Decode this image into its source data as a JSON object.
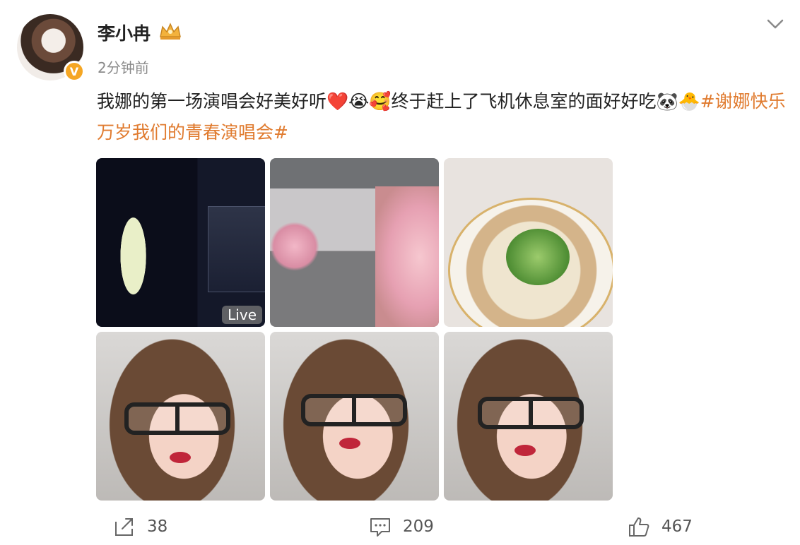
{
  "user": {
    "name": "李小冉",
    "time": "2分钟前",
    "verified_badge": "V"
  },
  "post": {
    "text": "我娜的第一场演唱会好美好听❤️😭🥰终于赶上了飞机休息室的面好好吃🐼🐣",
    "hashtag": "#谢娜快乐万岁我们的青春演唱会#",
    "hashtag_color": "#e07b2f"
  },
  "photos": [
    {
      "name": "concert-stage-photo",
      "badge": "Live"
    },
    {
      "name": "flower-hallway-photo",
      "badge": ""
    },
    {
      "name": "noodle-bowl-photo",
      "badge": ""
    },
    {
      "name": "selfie-eating-photo-1",
      "badge": ""
    },
    {
      "name": "selfie-eating-photo-2",
      "badge": ""
    },
    {
      "name": "selfie-eating-photo-3",
      "badge": ""
    }
  ],
  "actions": {
    "share_count": "38",
    "comment_count": "209",
    "like_count": "467"
  },
  "icons": [
    "crown-icon",
    "chevron-down-icon",
    "share-icon",
    "comment-icon",
    "like-icon"
  ]
}
